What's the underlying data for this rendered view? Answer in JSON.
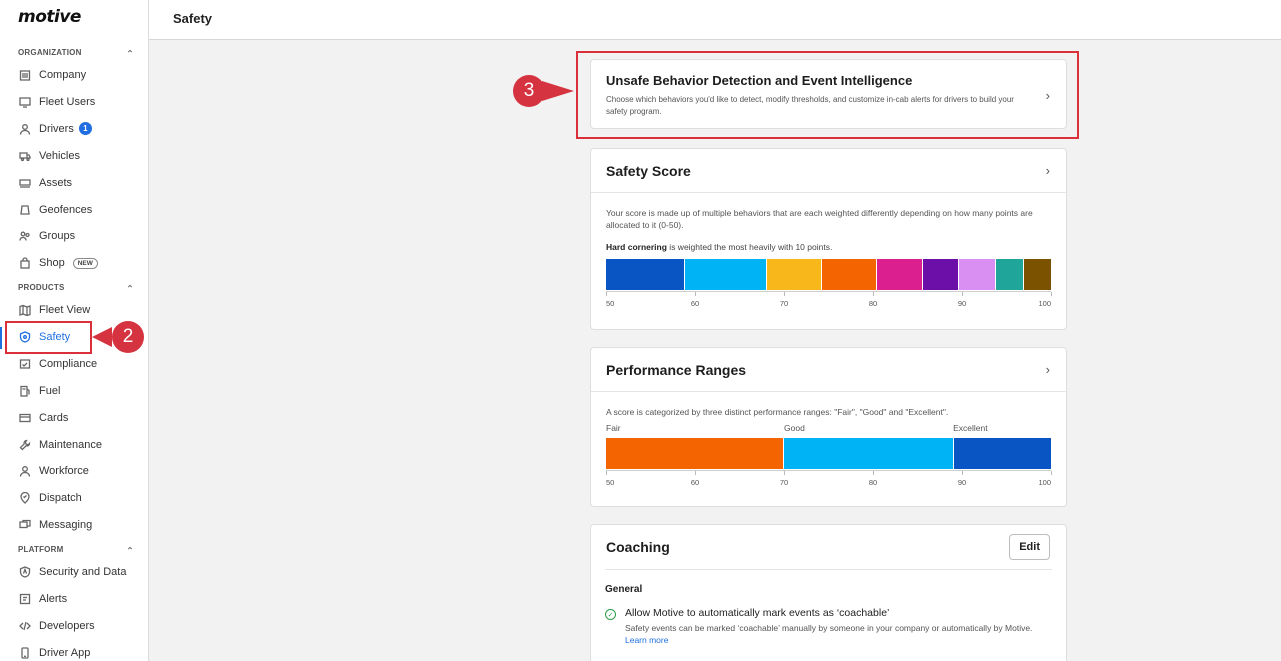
{
  "brand": {
    "logo": "motive"
  },
  "sidebar": {
    "organization_label": "ORGANIZATION",
    "organization_items": [
      {
        "label": "Company",
        "icon": "building-icon"
      },
      {
        "label": "Fleet Users",
        "icon": "monitor-icon"
      },
      {
        "label": "Drivers",
        "icon": "person-icon",
        "badge": "1"
      },
      {
        "label": "Vehicles",
        "icon": "truck-icon"
      },
      {
        "label": "Assets",
        "icon": "trailer-icon"
      },
      {
        "label": "Geofences",
        "icon": "geofence-icon"
      },
      {
        "label": "Groups",
        "icon": "group-icon"
      },
      {
        "label": "Shop",
        "icon": "bag-icon",
        "tag": "NEW"
      }
    ],
    "products_label": "PRODUCTS",
    "products_items": [
      {
        "label": "Fleet View",
        "icon": "map-icon"
      },
      {
        "label": "Safety",
        "icon": "shield-icon",
        "active": true
      },
      {
        "label": "Compliance",
        "icon": "compliance-icon"
      },
      {
        "label": "Fuel",
        "icon": "fuel-icon"
      },
      {
        "label": "Cards",
        "icon": "card-icon"
      },
      {
        "label": "Maintenance",
        "icon": "wrench-icon"
      },
      {
        "label": "Workforce",
        "icon": "person-icon"
      },
      {
        "label": "Dispatch",
        "icon": "dispatch-icon"
      },
      {
        "label": "Messaging",
        "icon": "message-icon"
      }
    ],
    "platform_label": "PLATFORM",
    "platform_items": [
      {
        "label": "Security and Data",
        "icon": "security-icon"
      },
      {
        "label": "Alerts",
        "icon": "alert-icon"
      },
      {
        "label": "Developers",
        "icon": "code-icon"
      },
      {
        "label": "Driver App",
        "icon": "phone-icon"
      }
    ]
  },
  "header": {
    "title": "Safety"
  },
  "annotations": {
    "step_2": "2",
    "step_3": "3",
    "color": "#d5333f"
  },
  "unsafe_card": {
    "title": "Unsafe Behavior Detection and Event Intelligence",
    "description": "Choose which behaviors you'd like to detect, modify thresholds, and customize in-cab alerts for drivers to build your safety program."
  },
  "safety_score": {
    "title": "Safety Score",
    "description": "Your score is made up of multiple behaviors that are each weighted differently depending on how many points are allocated to it (0-50).",
    "highlight_bold": "Hard cornering",
    "highlight_rest": " is weighted the most heavily with 10 points.",
    "segments": [
      {
        "color": "#0a55c4",
        "weight": 17.5
      },
      {
        "color": "#00b3f5",
        "weight": 18
      },
      {
        "color": "#f8b81c",
        "weight": 12
      },
      {
        "color": "#f46400",
        "weight": 12
      },
      {
        "color": "#dc1f8e",
        "weight": 10
      },
      {
        "color": "#6b0fa8",
        "weight": 8
      },
      {
        "color": "#d98ef2",
        "weight": 8
      },
      {
        "color": "#1fa59a",
        "weight": 6
      },
      {
        "color": "#7a5200",
        "weight": 6
      }
    ],
    "scale_labels": [
      "50",
      "60",
      "70",
      "80",
      "90",
      "100"
    ]
  },
  "performance_ranges": {
    "title": "Performance Ranges",
    "description": "A score is categorized by three distinct performance ranges: \"Fair\", \"Good\" and \"Excellent\".",
    "ranges": [
      {
        "label": "Fair",
        "color": "#f46400",
        "from": 50,
        "to": 70
      },
      {
        "label": "Good",
        "color": "#00b3f5",
        "from": 70,
        "to": 89
      },
      {
        "label": "Excellent",
        "color": "#0a55c4",
        "from": 89,
        "to": 100
      }
    ],
    "scale_labels": [
      "50",
      "60",
      "70",
      "80",
      "90",
      "100"
    ]
  },
  "coaching": {
    "title": "Coaching",
    "edit_label": "Edit",
    "section_label": "General",
    "option_label": "Allow Motive to automatically mark events as ‘coachable’",
    "option_desc": "Safety events can be marked ‘coachable’ manually by someone in your company or automatically by Motive.",
    "learn_more": "Learn more"
  }
}
